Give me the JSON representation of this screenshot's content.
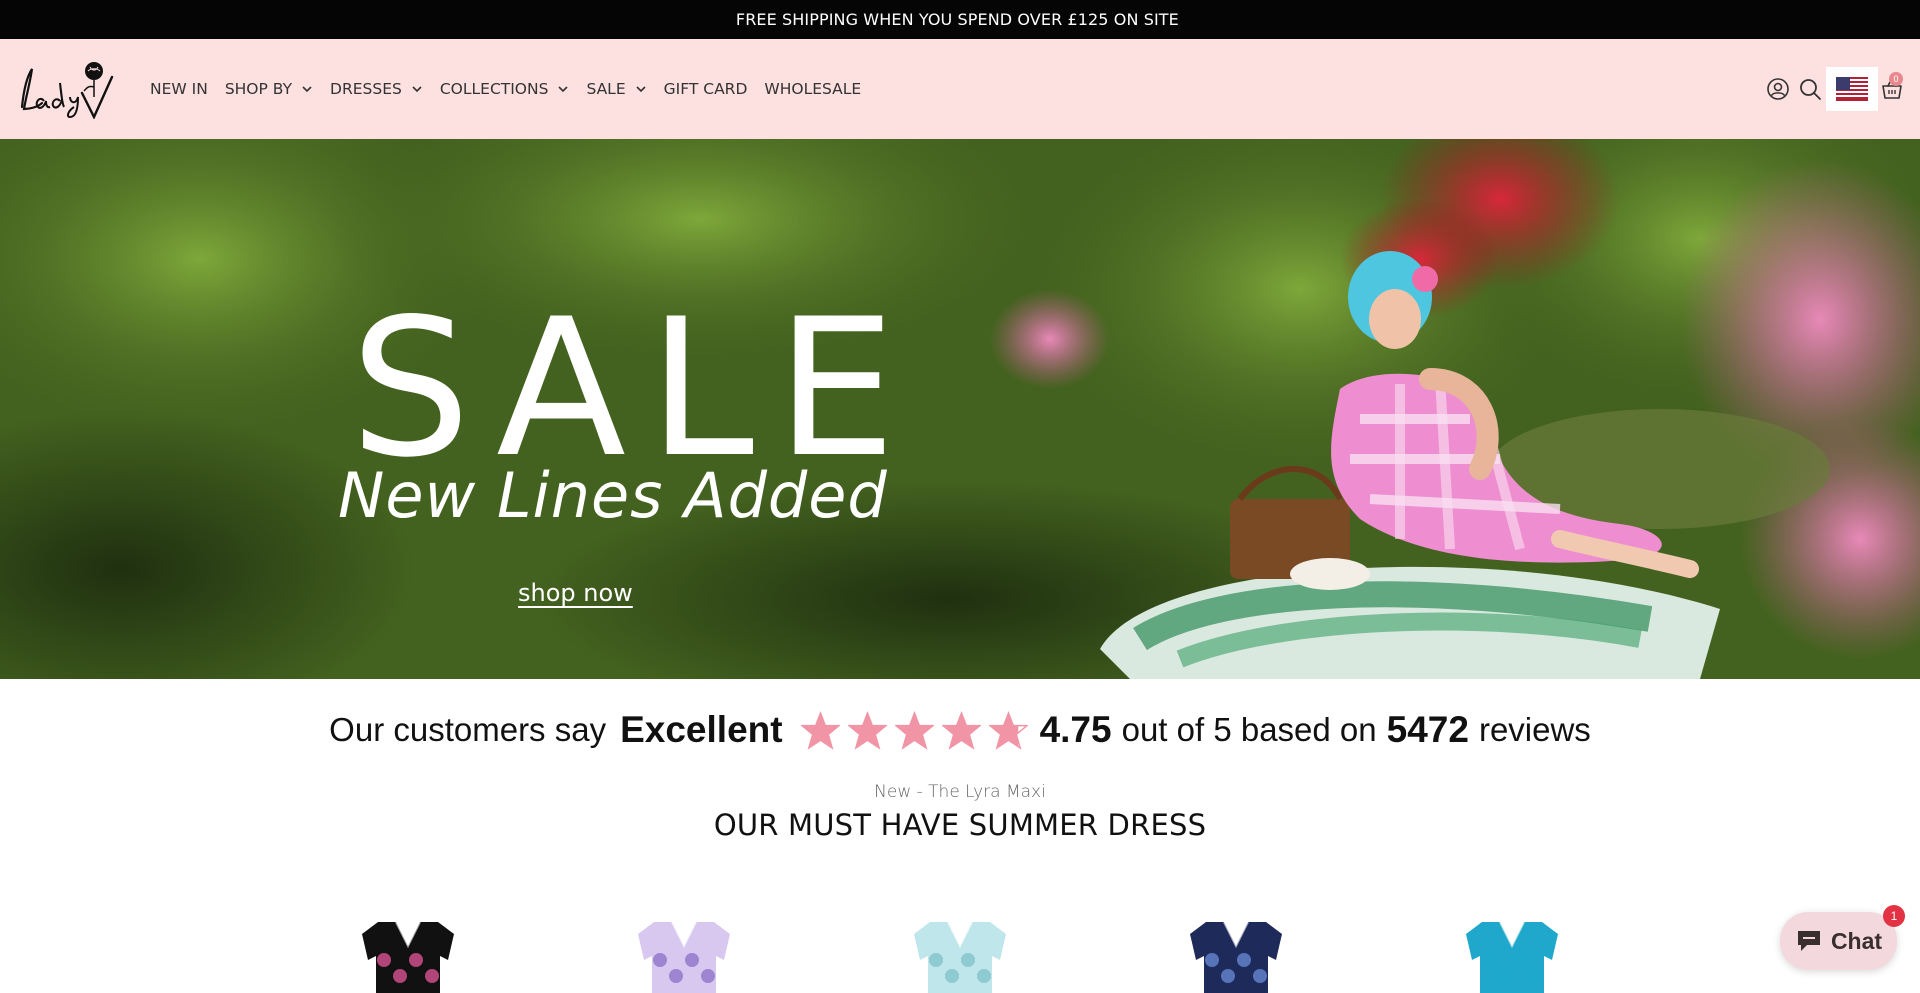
{
  "announcement": {
    "text": "FREE SHIPPING WHEN YOU SPEND OVER £125 ON SITE ⁨"
  },
  "brand": {
    "logo_alt": "Lady V",
    "logo_text": "Lady V"
  },
  "nav": {
    "items": [
      {
        "label": "NEW IN",
        "dropdown": false
      },
      {
        "label": "SHOP BY",
        "dropdown": true
      },
      {
        "label": "DRESSES",
        "dropdown": true
      },
      {
        "label": "COLLECTIONS",
        "dropdown": true
      },
      {
        "label": "SALE",
        "dropdown": true
      },
      {
        "label": "GIFT CARD",
        "dropdown": false
      },
      {
        "label": "WHOLESALE",
        "dropdown": false
      }
    ]
  },
  "header_icons": {
    "account": "account-icon",
    "search": "search-icon",
    "country": "us-flag-icon",
    "cart": "basket-icon",
    "cart_count": "0"
  },
  "hero": {
    "headline": "SALE",
    "subheadline": "New Lines Added",
    "cta": "shop now"
  },
  "reviews": {
    "prefix": "Our customers say",
    "rating_word": "Excellent",
    "score": "4.75",
    "middle": "out of 5 based on",
    "count": "5472",
    "suffix": "reviews",
    "stars": 4.75,
    "star_color": "#f195a6"
  },
  "section": {
    "kicker": "New - The Lyra Maxi",
    "title": "OUR MUST HAVE SUMMER DRESS"
  },
  "products": [
    {
      "color": "#111111",
      "accent": "#e7579a"
    },
    {
      "color": "#d8c8ef",
      "accent": "#8a6fc4"
    },
    {
      "color": "#bfe6ea",
      "accent": "#7fbfc8"
    },
    {
      "color": "#1e2a5a",
      "accent": "#6b8ed8"
    },
    {
      "color": "#1fa8cc",
      "accent": "#1fa8cc"
    }
  ],
  "chat": {
    "label": "Chat",
    "badge": "1"
  },
  "colors": {
    "announcement_bg": "#050505",
    "header_bg": "#fde0e0",
    "star_pink": "#f195a6"
  }
}
